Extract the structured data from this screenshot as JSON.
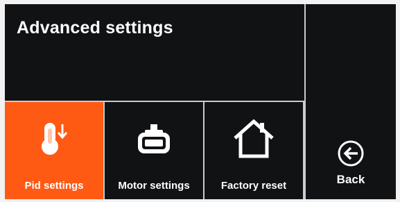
{
  "header": {
    "title": "Advanced settings"
  },
  "tiles": [
    {
      "label": "Pid settings",
      "icon": "thermometer-icon",
      "active": true
    },
    {
      "label": "Motor settings",
      "icon": "motor-icon",
      "active": false
    },
    {
      "label": "Factory reset",
      "icon": "home-icon",
      "active": false
    }
  ],
  "back": {
    "label": "Back",
    "icon": "back-arrow-icon"
  },
  "colors": {
    "accent": "#ff5a14",
    "background": "#111214",
    "divider": "#c9cdd2",
    "text": "#ffffff"
  }
}
